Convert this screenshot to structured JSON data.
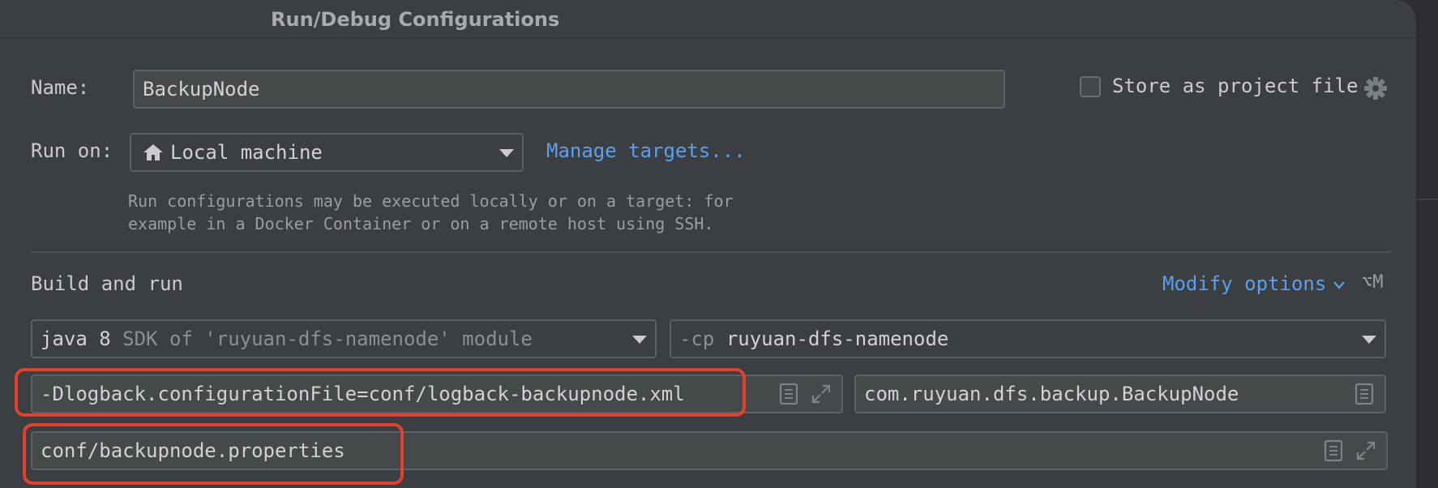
{
  "dialog": {
    "title": "Run/Debug Configurations"
  },
  "name_row": {
    "label": "Name:",
    "value": "BackupNode",
    "store_label": "Store as project file",
    "store_checked": false
  },
  "run_on_row": {
    "label": "Run on:",
    "selected": "Local machine",
    "manage_link": "Manage targets...",
    "hint_line1": "Run configurations may be executed locally or on a target: for",
    "hint_line2": "example in a Docker Container or on a remote host using SSH."
  },
  "build_run": {
    "section_label": "Build and run",
    "modify_link": "Modify options",
    "modify_shortcut": "⌥M",
    "jdk_main": "java 8",
    "jdk_detail": "SDK of 'ruyuan-dfs-namenode' module",
    "cp_flag": "-cp",
    "cp_module": "ruyuan-dfs-namenode",
    "vm_options": "-Dlogback.configurationFile=conf/logback-backupnode.xml",
    "main_class": "com.ruyuan.dfs.backup.BackupNode",
    "program_args": "conf/backupnode.properties"
  },
  "colors": {
    "link": "#5aa0ee",
    "highlight": "#e3402d"
  },
  "icons": [
    "home-icon",
    "chevron-down-icon",
    "gear-icon",
    "document-icon",
    "expand-icon"
  ]
}
